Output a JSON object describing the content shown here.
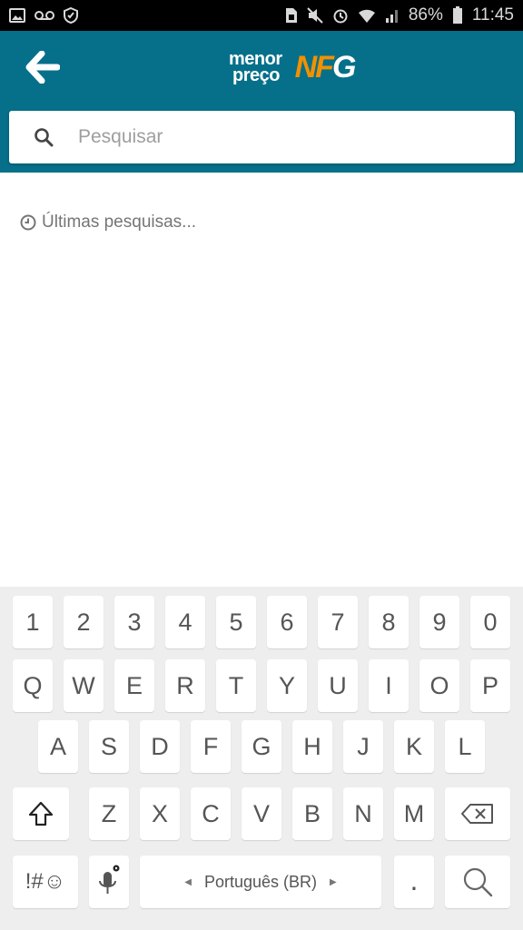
{
  "status_bar": {
    "battery": "86%",
    "time": "11:45"
  },
  "header": {
    "logo_line1": "menor",
    "logo_line2": "preço",
    "logo_mark_n": "NF",
    "logo_mark_g": "G"
  },
  "search": {
    "placeholder": "Pesquisar"
  },
  "recent": {
    "label": "Últimas pesquisas..."
  },
  "keyboard": {
    "row_numbers": [
      "1",
      "2",
      "3",
      "4",
      "5",
      "6",
      "7",
      "8",
      "9",
      "0"
    ],
    "row_top": [
      "Q",
      "W",
      "E",
      "R",
      "T",
      "Y",
      "U",
      "I",
      "O",
      "P"
    ],
    "row_middle": [
      "A",
      "S",
      "D",
      "F",
      "G",
      "H",
      "J",
      "K",
      "L"
    ],
    "row_bottom": [
      "Z",
      "X",
      "C",
      "V",
      "B",
      "N",
      "M"
    ],
    "symbols_label": "!#☺",
    "space_label": "Português (BR)",
    "period_label": "."
  },
  "colors": {
    "header_bg": "#06708a",
    "logo_accent": "#f29100"
  }
}
